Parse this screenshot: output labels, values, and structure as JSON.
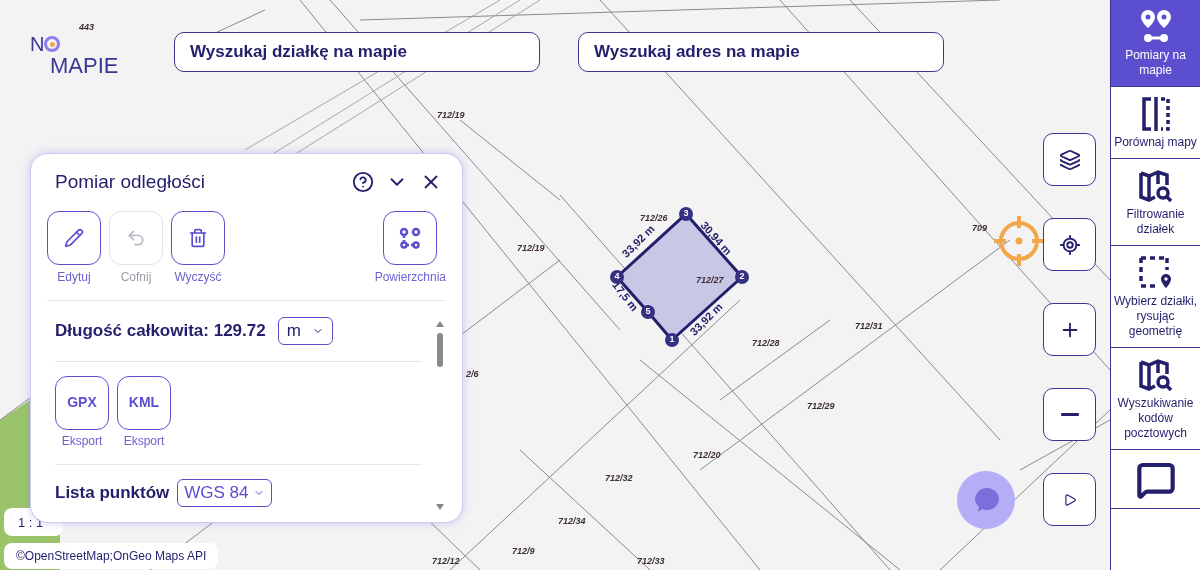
{
  "logo": {
    "line_1": "N",
    "line_2": "MAPIE"
  },
  "search_fields": [
    {
      "placeholder": "Wyszukaj działkę na mapie"
    },
    {
      "placeholder": "Wyszukaj adres na mapie"
    }
  ],
  "map": {
    "parcel_labels": [
      "443",
      "712/19",
      "712/26",
      "712/19",
      "712/27",
      "709",
      "712/28",
      "712/31",
      "712/29",
      "712/20",
      "712/32",
      "712/34",
      "712/9",
      "712/12",
      "712/33",
      "2/6"
    ],
    "measurement": {
      "vertices": [
        "1",
        "2",
        "3",
        "4",
        "5"
      ],
      "edge_labels": [
        "33,92 m",
        "30,94 m",
        "17,5 m",
        "33,92 m"
      ]
    },
    "scale": "1 : 1",
    "attribution": "©OpenStreetMap;OnGeo Maps API"
  },
  "panel": {
    "title": "Pomiar odległości",
    "tools": [
      {
        "kind": "edit",
        "label": "Edytuj",
        "disabled": false
      },
      {
        "kind": "undo",
        "label": "Cofnij",
        "disabled": true
      },
      {
        "kind": "clear",
        "label": "Wyczyść",
        "disabled": false
      },
      {
        "kind": "area",
        "label": "Powierzchnia",
        "disabled": false
      }
    ],
    "total": {
      "label": "Długość całkowita: 129.72",
      "unit": "m"
    },
    "exports": [
      {
        "format": "GPX",
        "label": "Eksport"
      },
      {
        "format": "KML",
        "label": "Eksport"
      }
    ],
    "points": {
      "label": "Lista punktów",
      "crs": "WGS 84"
    }
  },
  "map_controls": [
    {
      "kind": "layers"
    },
    {
      "kind": "locate"
    },
    {
      "kind": "zoom_in"
    },
    {
      "kind": "zoom_out"
    },
    {
      "kind": "expand"
    }
  ],
  "sidebar": {
    "items": [
      {
        "kind": "measure",
        "label": "Pomiary na mapie",
        "selected": true
      },
      {
        "kind": "compare",
        "label": "Porównaj mapy",
        "selected": false
      },
      {
        "kind": "filter",
        "label": "Filtrowanie działek",
        "selected": false
      },
      {
        "kind": "select",
        "label": "Wybierz działki, rysując geometrię",
        "selected": false
      },
      {
        "kind": "postal",
        "label": "Wyszukiwanie kodów pocztowych",
        "selected": false
      },
      {
        "kind": "chat",
        "selected": false
      }
    ]
  }
}
